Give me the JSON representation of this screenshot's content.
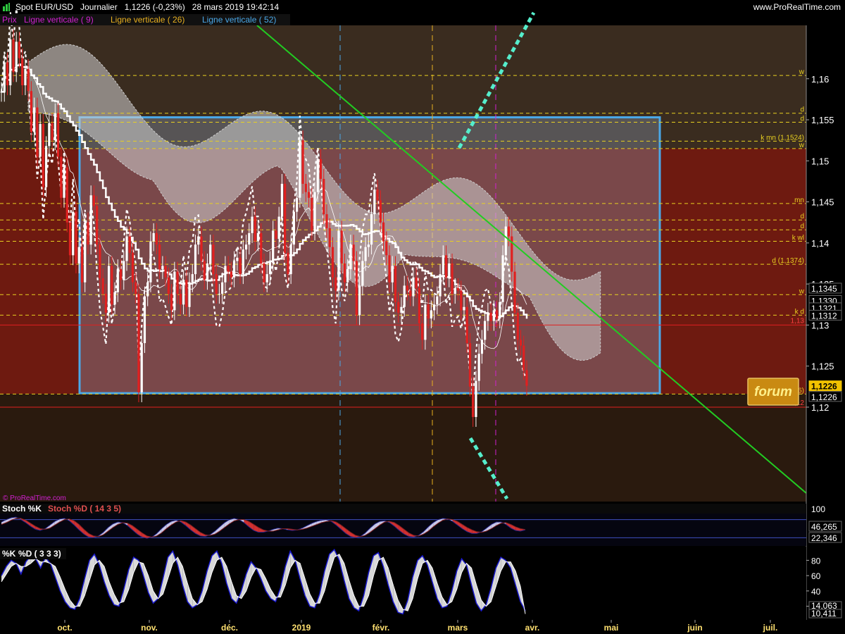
{
  "header": {
    "title": "Spot EUR/USD   Journalier   1,1226 (-0,23%)   28 mars 2019 19:42:14",
    "site": "www.ProRealTime.com"
  },
  "legend": {
    "price": "Prix",
    "v1": "Ligne verticale ( 9)",
    "v2": "Ligne verticale ( 26)",
    "v3": "Ligne verticale ( 52)"
  },
  "watermark": "© ProRealTime.com",
  "forum_label": "forum",
  "colors": {
    "bg_upper": "#3a2c1f",
    "bg_mid": "#6e1a10",
    "bg_lower": "#2a1a0e",
    "box_border": "#4aa8e8",
    "trend_green": "#22cc22",
    "cyan_dots": "#55eecc",
    "up_candle": "#ffffff",
    "down_candle": "#e02020"
  },
  "chart_data": [
    {
      "type": "line",
      "name": "price",
      "ylim": [
        1.1085,
        1.1665
      ],
      "y_ticks": [
        {
          "v": 1.16,
          "label": "1,16"
        },
        {
          "v": 1.155,
          "label": "1,155"
        },
        {
          "v": 1.15,
          "label": "1,15"
        },
        {
          "v": 1.145,
          "label": "1,145"
        },
        {
          "v": 1.14,
          "label": "1,14"
        },
        {
          "v": 1.135,
          "label": "1,135"
        },
        {
          "v": 1.13,
          "label": "1,13"
        },
        {
          "v": 1.125,
          "label": "1,125"
        },
        {
          "v": 1.12,
          "label": "1,12"
        }
      ],
      "x_labels": [
        "oct.",
        "nov.",
        "déc.",
        "2019",
        "févr.",
        "mars",
        "avr.",
        "mai",
        "juin",
        "juil."
      ],
      "close": [
        1.1584,
        1.162,
        1.1592,
        1.1648,
        1.1608,
        1.1645,
        1.1625,
        1.1592,
        1.1612,
        1.1585,
        1.1535,
        1.1565,
        1.1505,
        1.1545,
        1.1468,
        1.1518,
        1.1546,
        1.1525,
        1.1558,
        1.1505,
        1.1455,
        1.1492,
        1.1425,
        1.1385,
        1.1438,
        1.1375,
        1.1395,
        1.1352,
        1.1425,
        1.1398,
        1.1458,
        1.1445,
        1.1398,
        1.1357,
        1.1338,
        1.1315,
        1.1372,
        1.1325,
        1.134,
        1.1368,
        1.1355,
        1.1378,
        1.1408,
        1.1388,
        1.1352,
        1.1338,
        1.1218,
        1.1278,
        1.1335,
        1.1352,
        1.1402,
        1.1412,
        1.1398,
        1.1368,
        1.1372,
        1.1358,
        1.1338,
        1.1318,
        1.1365,
        1.1338,
        1.1325,
        1.1355,
        1.1322,
        1.1352,
        1.1362,
        1.1398,
        1.1408,
        1.1378,
        1.1355,
        1.1375,
        1.1398,
        1.1362,
        1.1338,
        1.1338,
        1.1352,
        1.1372,
        1.1365,
        1.1358,
        1.1378,
        1.1382,
        1.1362,
        1.1392,
        1.1398,
        1.1412,
        1.1432,
        1.1402,
        1.1412,
        1.1375,
        1.1352,
        1.1362,
        1.1378,
        1.1415,
        1.1405,
        1.1432,
        1.1472,
        1.1388,
        1.1362,
        1.1398,
        1.1438,
        1.1455,
        1.1525,
        1.1472,
        1.1462,
        1.1455,
        1.1415,
        1.1462,
        1.1502,
        1.1478,
        1.1435,
        1.1418,
        1.1395,
        1.1358,
        1.1342,
        1.1415,
        1.1375,
        1.1352,
        1.1368,
        1.1398,
        1.1378,
        1.1312,
        1.1348,
        1.1378,
        1.1395,
        1.1398,
        1.1435,
        1.1465,
        1.1452,
        1.1425,
        1.1402,
        1.1385,
        1.1352,
        1.1372,
        1.1328,
        1.1315,
        1.1322,
        1.1348,
        1.1342,
        1.1335,
        1.1358,
        1.1345,
        1.1302,
        1.1282,
        1.1325,
        1.1308,
        1.1318,
        1.1325,
        1.1335,
        1.1362,
        1.1385,
        1.1358,
        1.1375,
        1.1338,
        1.1345,
        1.1342,
        1.1318,
        1.1322,
        1.1278,
        1.1225,
        1.1188,
        1.1232,
        1.1265,
        1.1282,
        1.1305,
        1.1315,
        1.1305,
        1.1318,
        1.1308,
        1.1328,
        1.1385,
        1.142,
        1.1408,
        1.1365,
        1.1315,
        1.1282,
        1.1275,
        1.1245,
        1.1226
      ]
    },
    {
      "type": "line",
      "name": "Stoch %K / Stoch %D ( 14 3 5)",
      "ylim": [
        0,
        100
      ],
      "labels": [
        "Stoch %K",
        "Stoch %D ( 14 3 5)"
      ],
      "top_tick": "100",
      "last_values": [
        "46,265",
        "22,346"
      ],
      "k": [
        72,
        80,
        86,
        88,
        80,
        70,
        58,
        48,
        44,
        50,
        62,
        74,
        82,
        84,
        76,
        62,
        46,
        32,
        22,
        20,
        26,
        38,
        54,
        66,
        72,
        70,
        60,
        46,
        32,
        22,
        18,
        22,
        34,
        50,
        64,
        74,
        78,
        72,
        60,
        46,
        34,
        26,
        24,
        30,
        42,
        56,
        70,
        80,
        84,
        80,
        70,
        56,
        44,
        38,
        38,
        42,
        48,
        52,
        50,
        46,
        44,
        46,
        52,
        60,
        68,
        74,
        78,
        80,
        74,
        62,
        48,
        34,
        24,
        20,
        24,
        36,
        52,
        66,
        74,
        76,
        70,
        58,
        44,
        32,
        24,
        22,
        28,
        40,
        56,
        70,
        80,
        84,
        82,
        74,
        62,
        50,
        40,
        34,
        34,
        40,
        52,
        64,
        72,
        72,
        64,
        52,
        44,
        42,
        46
      ],
      "d": [
        64,
        70,
        78,
        84,
        84,
        78,
        68,
        58,
        50,
        48,
        52,
        62,
        72,
        80,
        82,
        76,
        64,
        48,
        34,
        26,
        24,
        30,
        42,
        54,
        64,
        70,
        68,
        60,
        48,
        36,
        26,
        22,
        26,
        36,
        50,
        62,
        72,
        76,
        72,
        62,
        50,
        38,
        30,
        28,
        32,
        42,
        54,
        66,
        76,
        80,
        80,
        74,
        64,
        54,
        46,
        42,
        42,
        46,
        50,
        50,
        48,
        46,
        48,
        52,
        58,
        64,
        70,
        74,
        76,
        72,
        62,
        50,
        38,
        28,
        24,
        28,
        38,
        50,
        62,
        72,
        74,
        70,
        60,
        48,
        36,
        28,
        26,
        32,
        42,
        56,
        68,
        78,
        82,
        80,
        74,
        64,
        54,
        46,
        40,
        38,
        42,
        50,
        60,
        68,
        70,
        64,
        56,
        50,
        47
      ]
    },
    {
      "type": "line",
      "name": "%K %D ( 3 3 3)",
      "ylim": [
        4,
        96
      ],
      "labels": [
        "%K",
        "%D ( 3 3 3)"
      ],
      "y_ticks": [
        {
          "v": 80,
          "label": "80"
        },
        {
          "v": 60,
          "label": "60"
        },
        {
          "v": 40,
          "label": "40"
        },
        {
          "v": 20,
          "label": "20"
        }
      ],
      "last_values": [
        "14,063",
        "10,411"
      ],
      "k": [
        60,
        72,
        80,
        76,
        62,
        78,
        86,
        82,
        70,
        84,
        76,
        58,
        40,
        26,
        18,
        16,
        30,
        56,
        80,
        88,
        74,
        52,
        34,
        22,
        20,
        42,
        68,
        84,
        80,
        60,
        38,
        24,
        30,
        56,
        84,
        92,
        74,
        48,
        26,
        18,
        22,
        40,
        66,
        86,
        92,
        76,
        50,
        30,
        24,
        40,
        62,
        78,
        70,
        56,
        40,
        30,
        26,
        44,
        72,
        92,
        80,
        56,
        34,
        20,
        18,
        36,
        66,
        88,
        94,
        80,
        54,
        30,
        18,
        14,
        34,
        64,
        86,
        90,
        72,
        48,
        26,
        12,
        10,
        28,
        58,
        80,
        86,
        74,
        52,
        30,
        18,
        20,
        40,
        66,
        82,
        74,
        48,
        24,
        14,
        22,
        44,
        70,
        84,
        80,
        70,
        48,
        26,
        14
      ],
      "d": [
        52,
        62,
        72,
        76,
        72,
        72,
        76,
        82,
        78,
        78,
        76,
        72,
        58,
        42,
        28,
        20,
        20,
        34,
        54,
        74,
        80,
        72,
        52,
        36,
        24,
        26,
        42,
        64,
        78,
        76,
        60,
        40,
        30,
        36,
        56,
        76,
        84,
        72,
        50,
        30,
        22,
        26,
        42,
        64,
        80,
        84,
        72,
        52,
        34,
        30,
        40,
        58,
        70,
        68,
        56,
        42,
        32,
        32,
        48,
        70,
        80,
        76,
        56,
        36,
        24,
        24,
        40,
        64,
        84,
        88,
        76,
        54,
        34,
        20,
        20,
        34,
        60,
        80,
        84,
        70,
        48,
        28,
        16,
        14,
        30,
        56,
        76,
        80,
        70,
        50,
        32,
        22,
        26,
        42,
        64,
        76,
        70,
        48,
        28,
        20,
        26,
        46,
        66,
        78,
        78,
        66,
        46,
        10
      ]
    }
  ],
  "levels": [
    {
      "v": 1.1604,
      "label": "w",
      "color": "#e8d020"
    },
    {
      "v": 1.1558,
      "label": "d",
      "color": "#e8d020"
    },
    {
      "v": 1.1547,
      "label": "d",
      "color": "#e8d020"
    },
    {
      "v": 1.1524,
      "label": "k mn (1,1524)",
      "color": "#e8d020"
    },
    {
      "v": 1.1515,
      "label": "w",
      "color": "#e8d020"
    },
    {
      "v": 1.1448,
      "label": "mn",
      "color": "#e8d020"
    },
    {
      "v": 1.1428,
      "label": "d",
      "color": "#e8d020"
    },
    {
      "v": 1.1416,
      "label": "d",
      "color": "#e8d020"
    },
    {
      "v": 1.1402,
      "label": "k wl",
      "color": "#e8d020"
    },
    {
      "v": 1.1374,
      "label": "d (1,1374)",
      "color": "#e8d020"
    },
    {
      "v": 1.1337,
      "label": "w",
      "color": "#e8d020"
    },
    {
      "v": 1.1312,
      "label": "k d",
      "color": "#e8d020"
    },
    {
      "v": 1.1216,
      "label": "w (1,1216)",
      "color": "#e8d020"
    }
  ],
  "price_tags": [
    {
      "v": 1.1345,
      "label": "1,1345"
    },
    {
      "v": 1.133,
      "label": "1,1330"
    },
    {
      "v": 1.1321,
      "label": "1,1321"
    },
    {
      "v": 1.1312,
      "label": "1,1312"
    },
    {
      "v": 1.1226,
      "label": "1,1226",
      "current": true
    },
    {
      "v": 1.1213,
      "label": "1,1226"
    }
  ],
  "red_levels": [
    {
      "v": 1.13,
      "label": "1,13"
    },
    {
      "v": 1.12,
      "label": "1,12"
    }
  ]
}
